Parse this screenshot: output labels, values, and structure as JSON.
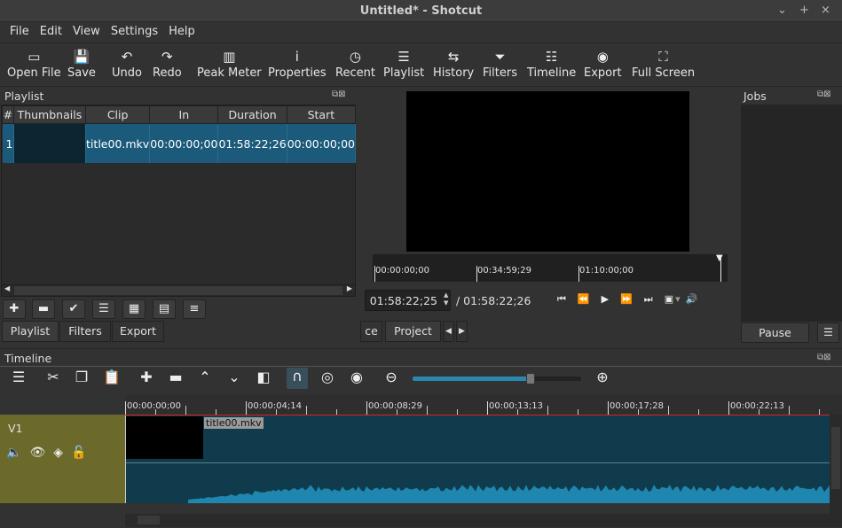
{
  "window": {
    "title": "Untitled* - Shotcut",
    "controls": [
      "⌄",
      "+",
      "×"
    ]
  },
  "menu": [
    "File",
    "Edit",
    "View",
    "Settings",
    "Help"
  ],
  "toolbar": [
    {
      "label": "Open File",
      "icon": "folder-open-icon",
      "glyph": "▭"
    },
    {
      "label": "Save",
      "icon": "save-icon",
      "glyph": "💾"
    },
    {
      "label": "Undo",
      "icon": "undo-icon",
      "glyph": "↶"
    },
    {
      "label": "Redo",
      "icon": "redo-icon",
      "glyph": "↷"
    },
    {
      "label": "Peak Meter",
      "icon": "peak-meter-icon",
      "glyph": "▥"
    },
    {
      "label": "Properties",
      "icon": "info-icon",
      "glyph": "i"
    },
    {
      "label": "Recent",
      "icon": "clock-icon",
      "glyph": "◷"
    },
    {
      "label": "Playlist",
      "icon": "list-icon",
      "glyph": "☰"
    },
    {
      "label": "History",
      "icon": "history-icon",
      "glyph": "⇆"
    },
    {
      "label": "Filters",
      "icon": "filter-icon",
      "glyph": "⏷"
    },
    {
      "label": "Timeline",
      "icon": "timeline-icon",
      "glyph": "☷"
    },
    {
      "label": "Export",
      "icon": "export-icon",
      "glyph": "◉"
    },
    {
      "label": "Full Screen",
      "icon": "fullscreen-icon",
      "glyph": "⛶"
    }
  ],
  "playlist": {
    "title": "Playlist",
    "columns": [
      "#",
      "Thumbnails",
      "Clip",
      "In",
      "Duration",
      "Start"
    ],
    "rows": [
      {
        "num": "1",
        "clip": "title00.mkv",
        "in": "00:00:00;00",
        "duration": "01:58:22;26",
        "start": "00:00:00;00"
      }
    ],
    "tabs": [
      "Playlist",
      "Filters",
      "Export"
    ]
  },
  "player": {
    "ruler": [
      "00:00:00;00",
      "00:34:59;29",
      "01:10:00;00"
    ],
    "current_time": "01:58:22;25",
    "total_time": "/ 01:58:22;26",
    "tabs": [
      "ce",
      "Project"
    ]
  },
  "jobs": {
    "title": "Jobs",
    "pause_label": "Pause"
  },
  "timeline": {
    "title": "Timeline",
    "ruler": [
      "00:00:00;00",
      "00:00:04;14",
      "00:00:08;29",
      "00:00:13;13",
      "00:00:17;28",
      "00:00:22;13"
    ],
    "track": "V1",
    "clip": "title00.mkv",
    "zoom_level": 0.7
  },
  "colors": {
    "selection": "#1b5a7a",
    "track_header": "#6b6a2a",
    "clip_bg": "#0f3b4c",
    "waveform": "#1f86b0",
    "playhead": "#e02020"
  }
}
